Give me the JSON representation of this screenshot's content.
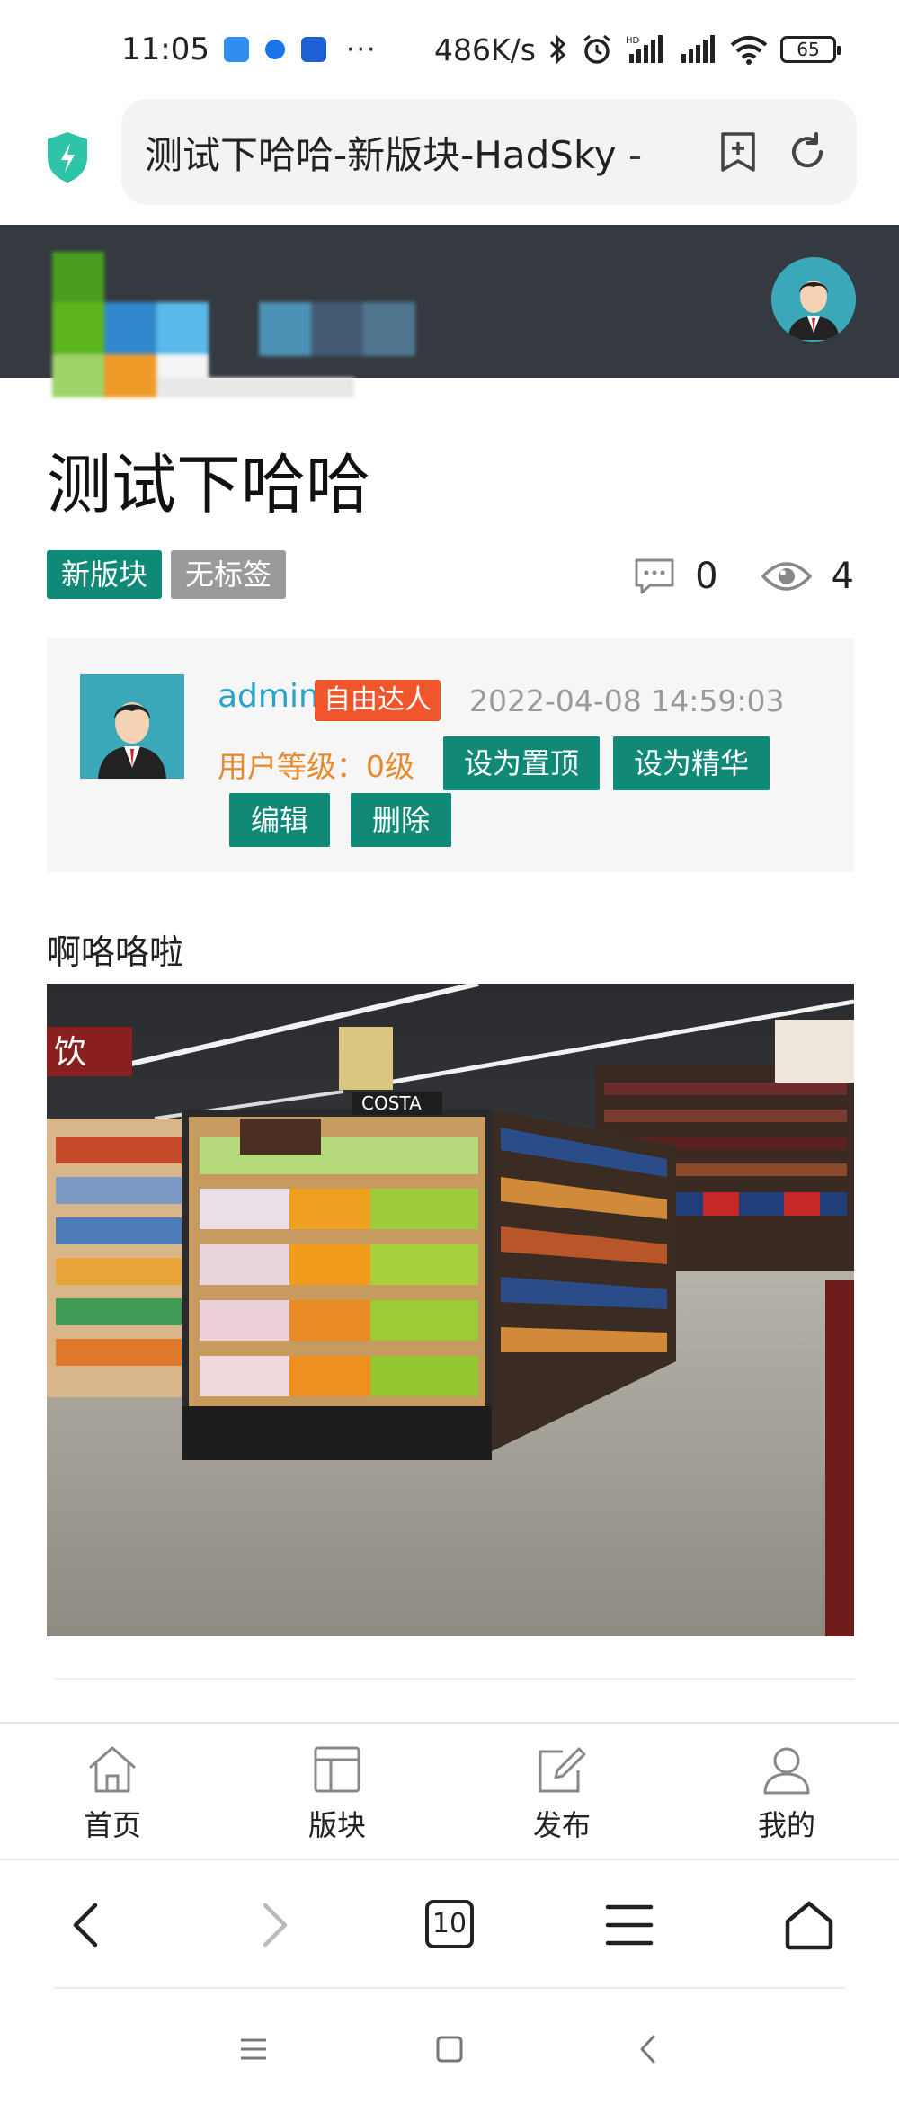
{
  "status_bar": {
    "time": "11:05",
    "more": "···",
    "net_speed": "486K/s",
    "battery": "65",
    "hd_label": "HD"
  },
  "browser": {
    "address_text": "测试下哈哈-新版块-HadSky -",
    "tab_count": "10"
  },
  "post": {
    "title": "测试下哈哈",
    "tags": [
      "新版块",
      "无标签"
    ],
    "comment_count": "0",
    "view_count": "4",
    "body": "啊咯咯啦"
  },
  "author": {
    "name": "admin",
    "badge": "自由达人",
    "date": "2022-04-08 14:59:03",
    "level": "用户等级：0级",
    "actions": {
      "pin": "设为置顶",
      "essence": "设为精华",
      "edit": "编辑",
      "delete": "删除"
    }
  },
  "site_nav": [
    "首页",
    "版块",
    "发布",
    "我的"
  ],
  "colors": {
    "accent": "#108a76",
    "header_bg": "#343a40",
    "badge": "#f0552c",
    "level_text": "#e68a2e",
    "name_link": "#2aa3c8"
  },
  "icons": [
    "shield-icon",
    "bookmark-add-icon",
    "refresh-icon",
    "comment-icon",
    "eye-icon",
    "home-icon",
    "board-icon",
    "publish-icon",
    "user-icon",
    "back-icon",
    "forward-icon",
    "menu-icon",
    "home-shape-icon"
  ]
}
